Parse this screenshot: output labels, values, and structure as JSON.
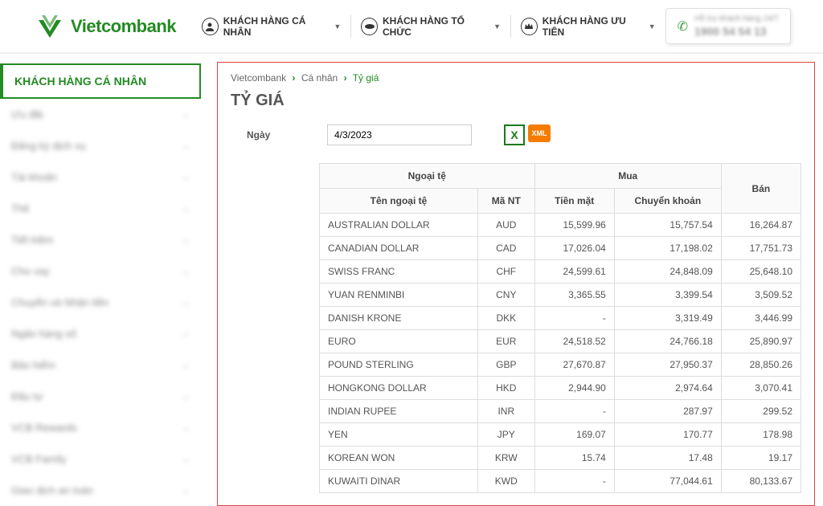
{
  "logo": {
    "text": "Vietcombank"
  },
  "nav": {
    "items": [
      {
        "label": "KHÁCH HÀNG CÁ NHÂN"
      },
      {
        "label": "KHÁCH HÀNG TỔ CHỨC"
      },
      {
        "label": "KHÁCH HÀNG ƯU TIÊN"
      }
    ]
  },
  "phone": {
    "label_line1": "Hỗ trợ khách hàng 24/7",
    "number": "1900 54 54 13"
  },
  "sidebar": {
    "active": "KHÁCH HÀNG CÁ NHÂN",
    "items": [
      {
        "label": "Ưu đãi"
      },
      {
        "label": "Đăng ký dịch vụ"
      },
      {
        "label": "Tài khoản"
      },
      {
        "label": "Thẻ"
      },
      {
        "label": "Tiết kiệm"
      },
      {
        "label": "Cho vay"
      },
      {
        "label": "Chuyển và Nhận tiền"
      },
      {
        "label": "Ngân hàng số"
      },
      {
        "label": "Bảo hiểm"
      },
      {
        "label": "Đầu tư"
      },
      {
        "label": "VCB Rewards"
      },
      {
        "label": "VCB Family"
      },
      {
        "label": "Giao dịch an toàn"
      }
    ]
  },
  "breadcrumb": {
    "items": [
      {
        "label": "Vietcombank"
      },
      {
        "label": "Cá nhân"
      },
      {
        "label": "Tỷ giá",
        "active": true
      }
    ]
  },
  "page_title": "TỶ GIÁ",
  "filter": {
    "date_label": "Ngày",
    "date_value": "4/3/2023"
  },
  "table": {
    "headers": {
      "ngoai_te": "Ngoại tệ",
      "mua": "Mua",
      "ban": "Bán",
      "ten": "Tên ngoại tệ",
      "ma": "Mã NT",
      "tien_mat": "Tiền mặt",
      "chuyen_khoan": "Chuyển khoản"
    },
    "rows": [
      {
        "name": "AUSTRALIAN DOLLAR",
        "code": "AUD",
        "cash": "15,599.96",
        "transfer": "15,757.54",
        "sell": "16,264.87"
      },
      {
        "name": "CANADIAN DOLLAR",
        "code": "CAD",
        "cash": "17,026.04",
        "transfer": "17,198.02",
        "sell": "17,751.73"
      },
      {
        "name": "SWISS FRANC",
        "code": "CHF",
        "cash": "24,599.61",
        "transfer": "24,848.09",
        "sell": "25,648.10"
      },
      {
        "name": "YUAN RENMINBI",
        "code": "CNY",
        "cash": "3,365.55",
        "transfer": "3,399.54",
        "sell": "3,509.52"
      },
      {
        "name": "DANISH KRONE",
        "code": "DKK",
        "cash": "-",
        "transfer": "3,319.49",
        "sell": "3,446.99"
      },
      {
        "name": "EURO",
        "code": "EUR",
        "cash": "24,518.52",
        "transfer": "24,766.18",
        "sell": "25,890.97"
      },
      {
        "name": "POUND STERLING",
        "code": "GBP",
        "cash": "27,670.87",
        "transfer": "27,950.37",
        "sell": "28,850.26"
      },
      {
        "name": "HONGKONG DOLLAR",
        "code": "HKD",
        "cash": "2,944.90",
        "transfer": "2,974.64",
        "sell": "3,070.41"
      },
      {
        "name": "INDIAN RUPEE",
        "code": "INR",
        "cash": "-",
        "transfer": "287.97",
        "sell": "299.52"
      },
      {
        "name": "YEN",
        "code": "JPY",
        "cash": "169.07",
        "transfer": "170.77",
        "sell": "178.98"
      },
      {
        "name": "KOREAN WON",
        "code": "KRW",
        "cash": "15.74",
        "transfer": "17.48",
        "sell": "19.17"
      },
      {
        "name": "KUWAITI DINAR",
        "code": "KWD",
        "cash": "-",
        "transfer": "77,044.61",
        "sell": "80,133.67"
      }
    ]
  }
}
